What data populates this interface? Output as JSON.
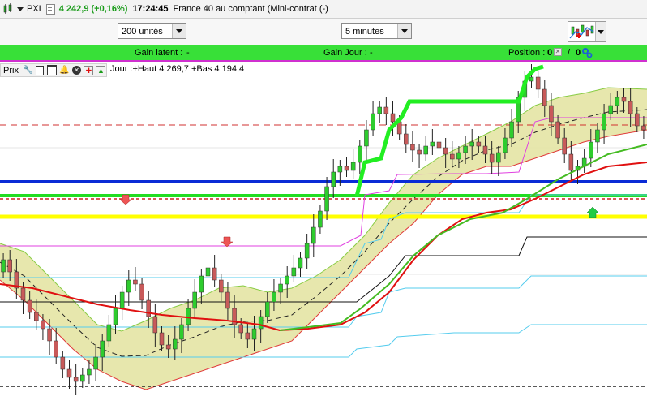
{
  "titlebar": {
    "symbol": "PXI",
    "price": "4 242,9 (+0,16%)",
    "time": "17:24:45",
    "instrument": "France 40 au comptant (Mini-contrat  (-)"
  },
  "toolbar": {
    "quantity": "200 unités",
    "interval": "5 minutes"
  },
  "gainbar": {
    "latent_label": "Gain latent :",
    "latent_value": "-",
    "jour_label": "Gain Jour :",
    "jour_value": "-",
    "position_label": "Position :",
    "position_value": "0",
    "position_sep": "/",
    "position_value2": "0"
  },
  "chart_header": {
    "prix_label": "Prix",
    "jour_text": "Jour :+Haut 4 269,7 +Bas 4 194,4"
  },
  "colors": {
    "up_candle": "#2ecc2e",
    "down_candle": "#c85a5a",
    "band_fill": "#e4e4a4",
    "ma_red": "#e01010",
    "ma_green": "#44bb22",
    "supertrend": "#22ee22",
    "blue_level": "#0a2bd6",
    "yellow_level": "#ffff00"
  }
}
